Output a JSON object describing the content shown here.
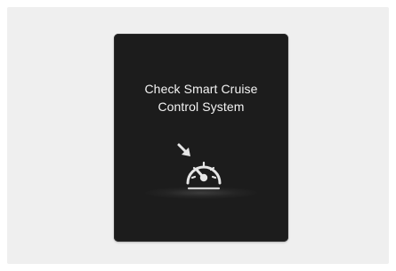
{
  "display": {
    "message_line1": "Check Smart Cruise",
    "message_line2": "Control System",
    "icon": "speedometer-warning-icon",
    "colors": {
      "screen": "#1c1c1c",
      "text": "#f4f4f4",
      "icon": "#e6e6e6",
      "background": "#efefef"
    }
  }
}
